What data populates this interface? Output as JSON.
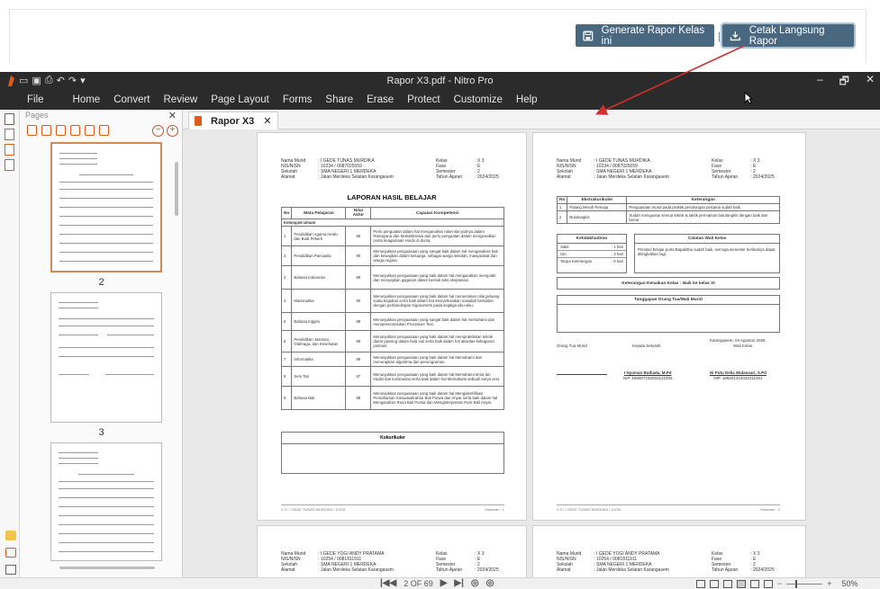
{
  "web": {
    "generate_label": "Generate Rapor Kelas ini",
    "separator": "|",
    "cetak_label": "Cetak Langsung Rapor"
  },
  "window": {
    "title": "Rapor X3.pdf - Nitro Pro",
    "controls": [
      "–",
      "🗗",
      "✕"
    ]
  },
  "menu": [
    "File",
    "Home",
    "Convert",
    "Review",
    "Page Layout",
    "Forms",
    "Share",
    "Erase",
    "Protect",
    "Customize",
    "Help"
  ],
  "pages_panel": {
    "title": "Pages",
    "close": "✕",
    "thumb_labels": [
      "2",
      "3"
    ]
  },
  "tab": {
    "label": "Rapor X3",
    "close": "✕"
  },
  "page_left": {
    "header_left": [
      "Nama Murid",
      "NIS/NISN",
      "Sekolah",
      "Alamat"
    ],
    "header_left_values": [
      ": I GEDE TUNAS MURDIKA",
      ": 10234 / 0087025059",
      ": SMA NEGERI 1 MERDEKA",
      ": Jalan Merdeka Selatan Karangasem"
    ],
    "header_right": [
      "Kelas",
      "Fase",
      "Semester",
      "Tahun Ajaran"
    ],
    "header_right_values": [
      ": X 3",
      ": E",
      ": 2",
      ": 2024/2025"
    ],
    "title": "LAPORAN HASIL BELAJAR",
    "columns": [
      "No",
      "Mata Pelajaran",
      "Nilai Akhir",
      "Capaian Kompetensi"
    ],
    "group": "Kelompok Umum",
    "rows": [
      {
        "no": "1",
        "subject": "Pendidikan Agama Hindu dan Budi Pekerti",
        "score": "86",
        "desc": "Perlu penguatan dalam hal menganalisis nilai-nilai yadnya dalam Ramayana dan Mahabharata dan perlu penguatan dalam mengenalkan cerita keagamaan Hindu di dunia."
      },
      {
        "no": "2",
        "subject": "Pendidikan Pancasila",
        "score": "90",
        "desc": "Menunjukkan penguasaan yang sangat baik dalam hal menganalisis hak dan kewajiban dalam keluarga, sebagai warga sekolah, masyarakat dan warga negara."
      },
      {
        "no": "3",
        "subject": "Bahasa Indonesia",
        "score": "89",
        "desc": "Menunjukkan penguasaan yang baik dalam hal menganalisis mengolah dan menyajikan gagasan dalam bentuk teks eksplanasi."
      },
      {
        "no": "4",
        "subject": "Matematika",
        "score": "90",
        "desc": "Menunjukkan penguasaan yang baik dalam hal menentukan nilai peluang suatu kejadian serta baik dalam hal menyelesaikan masalah berkaitan dengan perbandingan trigonometri pada segitiga siku-siku."
      },
      {
        "no": "5",
        "subject": "Bahasa Inggris",
        "score": "88",
        "desc": "Menunjukkan penguasaan yang sangat baik dalam hal memahami dan mempresentasikan Procedure Text."
      },
      {
        "no": "6",
        "subject": "Pendidikan Jasmani, Olahraga, dan Kesehatan",
        "score": "88",
        "desc": "Menunjukkan penguasaan yang baik dalam hal mempraktikkan teknik dasar passing dalam bola voli serta baik dalam hal aktivitas kebugaran jasmani."
      },
      {
        "no": "7",
        "subject": "Informatika",
        "score": "89",
        "desc": "Menunjukkan penguasaan yang baik dalam hal Memahami dan menerapkan algoritma dan pemrograman."
      },
      {
        "no": "8",
        "subject": "Seni Tari",
        "score": "87",
        "desc": "Menunjukkan penguasaan yang baik dalam hal Memahami tema tari tradisi dan kontinuitas serta baik dalam hal Memahami sebuah karya seni."
      },
      {
        "no": "9",
        "subject": "Bahasa Bali",
        "score": "88",
        "desc": "Menunjukkan penguasaan yang baik dalam hal Mengidentifikasi Pemahaman Kaswasalirahan Bali Purwa dan Anyar serta baik dalam hal Menganalisis Rusa Bali Purwa dan Menginterpretasi Puisi Bali Anyar."
      }
    ],
    "kokurikuler": "Kokurikuler",
    "footer_left": "X 3 / I GEDE TUNAS MURDIKA / 10234",
    "footer_right": "Halaman : 1"
  },
  "page_right": {
    "ekstra_cols": [
      "No",
      "Ekstrakurikuler",
      "Keterangan"
    ],
    "ekstra_rows": [
      {
        "no": "1",
        "name": "Palang Merah Remaja",
        "desc": "Penguasaan murid pada praktik pertolongan pertama sudah baik."
      },
      {
        "no": "2",
        "name": "Bulutangkis",
        "desc": "Sudah menguasai semua teknik & taktik permainan bulutangkis dengan baik dan benar"
      }
    ],
    "ketidakhadiran_title": "Ketidakhadiran",
    "absensi": [
      {
        "label": "Sakit",
        "value": ": 1 hari"
      },
      {
        "label": "Izin",
        "value": ": 3 hari"
      },
      {
        "label": "Tanpa Keterangan",
        "value": ": 0 hari"
      }
    ],
    "catatan_title": "Catatan Wali Kelas",
    "catatan_text": "Prestasi belajar putra Bapak/Ibu sudah baik, semoga semester berikutnya dapat ditingkatkan lagi.",
    "kenaikan": "Keterangan Kenaikan Kelas : Naik ke kelas XI",
    "tanggapan_title": "Tanggapan Orang Tua/Wali Murid",
    "place_date": "Karangasem, 04 Agustus 2025",
    "ortu": "Orang Tua Murid",
    "kepsek": "Kepala Sekolah",
    "wali": "Wali Kelas",
    "kepsek_name": "I Nyoman Budiada, M.Pd",
    "kepsek_nip": "NIP. 198007162003121005",
    "wali_name": "Ni Putu Delia Wulansari, S.Pd",
    "wali_nip": "NIP. 199201312022211001",
    "footer_left": "X 3 / I GEDE TUNAS MURDIKA / 10234",
    "footer_right": "Halaman : 2"
  },
  "page_bottom_left": {
    "header_left_values": [
      ": I GEDE YOGI ANDY PRATAMA",
      ": 10254 / 0081811911",
      ": SMA NEGERI 1 MERDEKA",
      ": Jalan Merdeka Selatan Karangasem"
    ]
  },
  "page_bottom_right": {
    "header_left_values": [
      ": I GEDE YOGI ANDY PRATAMA",
      ": 10254 / 0081811911",
      ": SMA NEGERI 1 MERDEKA",
      ": Jalan Merdeka Selatan Karangasem"
    ]
  },
  "status": {
    "page_indicator": "2 OF 69",
    "zoom": "50%"
  },
  "colors": {
    "web_button": "#4a6780",
    "annotation_arrow": "#d32f2f",
    "app_dark": "#2b2b2b",
    "nitro_orange": "#e05a1c"
  }
}
